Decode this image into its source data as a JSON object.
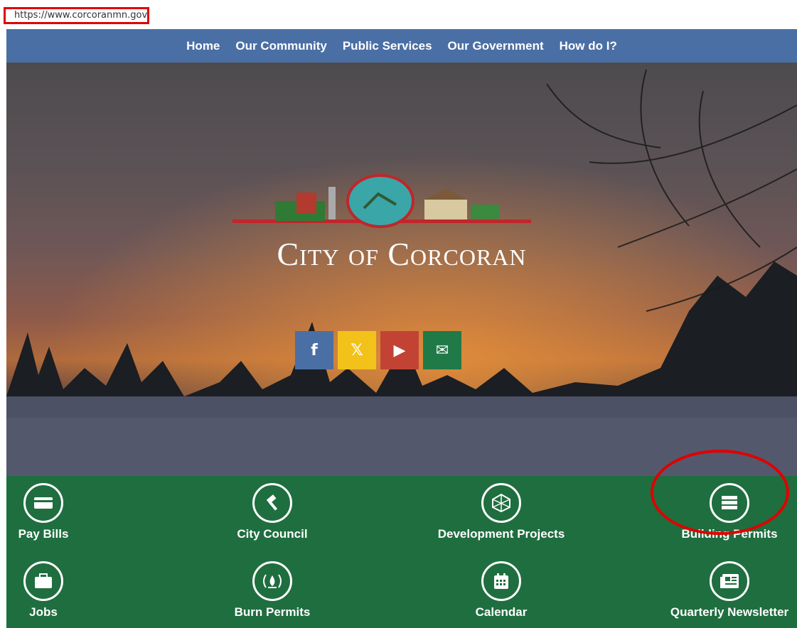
{
  "address_bar": {
    "url": "https://www.corcoranmn.gov"
  },
  "nav": {
    "items": [
      "Home",
      "Our Community",
      "Public Services",
      "Our Government",
      "How do I?"
    ]
  },
  "hero": {
    "title": "City of Corcoran"
  },
  "social": [
    {
      "name": "facebook-icon",
      "glyph": "f",
      "color": "#4a6fa5"
    },
    {
      "name": "x-icon",
      "glyph": "𝕏",
      "color": "#f2c21b"
    },
    {
      "name": "youtube-icon",
      "glyph": "▶",
      "color": "#c24334"
    },
    {
      "name": "email-icon",
      "glyph": "✉",
      "color": "#1f7a48"
    }
  ],
  "tiles": [
    {
      "label": "Pay Bills",
      "icon": "credit-card-icon"
    },
    {
      "label": "City Council",
      "icon": "gavel-icon"
    },
    {
      "label": "Development Projects",
      "icon": "blueprint-icon"
    },
    {
      "label": "Building Permits",
      "icon": "server-stack-icon"
    },
    {
      "label": "Jobs",
      "icon": "briefcase-icon"
    },
    {
      "label": "Burn Permits",
      "icon": "fire-icon"
    },
    {
      "label": "Calendar",
      "icon": "calendar-icon"
    },
    {
      "label": "Quarterly Newsletter",
      "icon": "newspaper-icon"
    }
  ],
  "colors": {
    "nav": "#4a6fa5",
    "tiles": "#1f6e3f",
    "highlight": "#e00000"
  }
}
